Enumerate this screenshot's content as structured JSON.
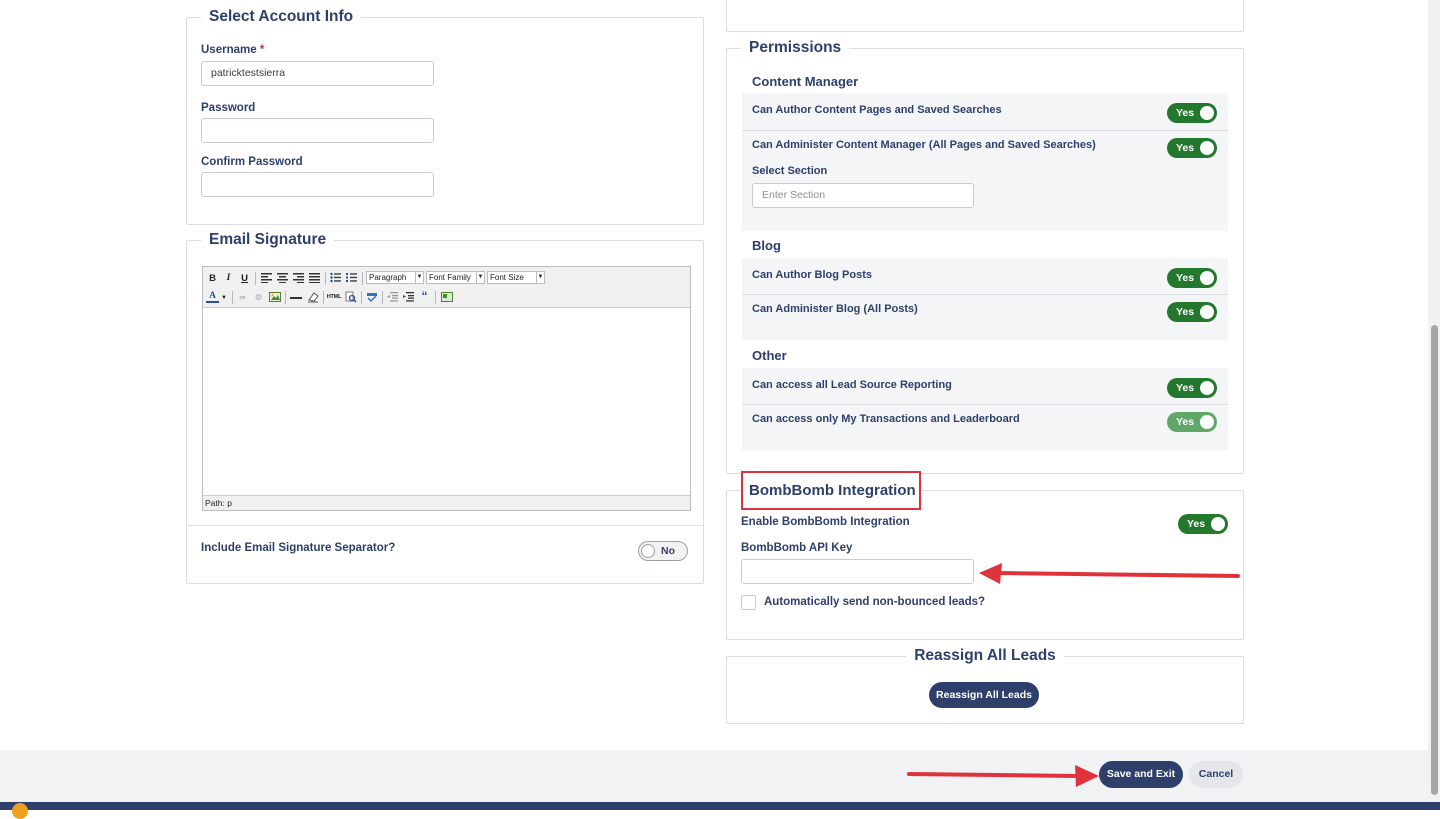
{
  "account": {
    "legend": "Select Account Info",
    "username_label": "Username",
    "username_required": "*",
    "username_value": "patricktestsierra",
    "password_label": "Password",
    "confirm_label": "Confirm Password"
  },
  "signature": {
    "legend": "Email Signature",
    "toolbar": {
      "bold": "B",
      "italic": "I",
      "underline": "U",
      "format_select": "Paragraph",
      "font_family_select": "Font Family",
      "font_size_select": "Font Size",
      "icons": [
        "bold-icon",
        "italic-icon",
        "underline-icon",
        "align-left-icon",
        "align-center-icon",
        "align-right-icon",
        "align-justify-icon",
        "bullet-list-icon",
        "numbered-list-icon",
        "text-color-icon",
        "link-icon",
        "unlink-icon",
        "image-icon",
        "horizontal-rule-icon",
        "eraser-icon",
        "html-icon",
        "find-replace-icon",
        "spellcheck-icon",
        "outdent-icon",
        "indent-icon",
        "blockquote-icon",
        "insert-media-icon"
      ]
    },
    "html_label": "HTML",
    "path_label": "Path: p",
    "separator_label": "Include Email Signature Separator?",
    "separator_toggle": "No"
  },
  "permissions": {
    "legend": "Permissions",
    "content_manager": {
      "title": "Content Manager",
      "rows": [
        {
          "label": "Can Author Content Pages and Saved Searches",
          "toggle": "Yes"
        },
        {
          "label": "Can Administer Content Manager (All Pages and Saved Searches)",
          "toggle": "Yes"
        }
      ],
      "section_label": "Select Section",
      "section_placeholder": "Enter Section"
    },
    "blog": {
      "title": "Blog",
      "rows": [
        {
          "label": "Can Author Blog Posts",
          "toggle": "Yes"
        },
        {
          "label": "Can Administer Blog (All Posts)",
          "toggle": "Yes"
        }
      ]
    },
    "other": {
      "title": "Other",
      "rows": [
        {
          "label": "Can access all Lead Source Reporting",
          "toggle": "Yes"
        },
        {
          "label": "Can access only My Transactions and Leaderboard",
          "toggle": "Yes"
        }
      ]
    }
  },
  "bombbomb": {
    "legend": "BombBomb Integration",
    "enable_label": "Enable BombBomb Integration",
    "enable_toggle": "Yes",
    "api_key_label": "BombBomb API Key",
    "auto_send_label": "Automatically send non-bounced leads?"
  },
  "reassign": {
    "legend": "Reassign All Leads",
    "button": "Reassign All Leads"
  },
  "footer": {
    "save_button": "Save and Exit",
    "cancel_button": "Cancel"
  },
  "colors": {
    "brand_navy": "#2f3f6b",
    "toggle_green": "#23782e",
    "highlight_red": "#e0323a"
  }
}
